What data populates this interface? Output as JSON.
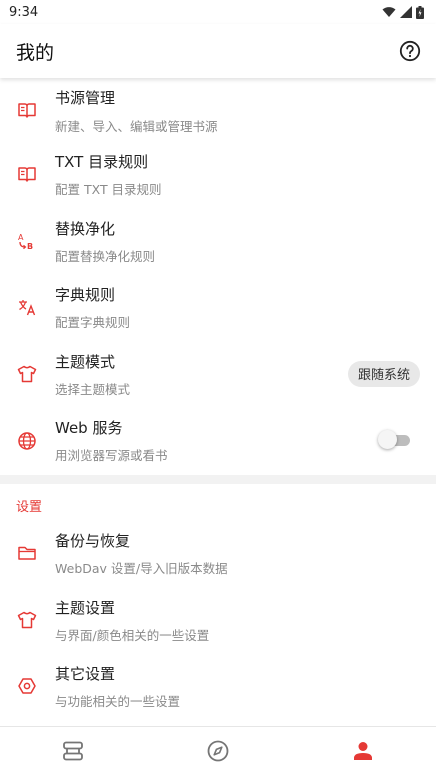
{
  "status_bar": {
    "time": "9:34"
  },
  "app_bar": {
    "title": "我的"
  },
  "colors": {
    "accent": "#e53935",
    "icon_gray": "#757575"
  },
  "items": [
    {
      "title": "书源管理",
      "subtitle": "新建、导入、编辑或管理书源",
      "icon": "book-icon"
    },
    {
      "title": "TXT 目录规则",
      "subtitle": "配置 TXT 目录规则",
      "icon": "book-icon"
    },
    {
      "title": "替换净化",
      "subtitle": "配置替换净化规则",
      "icon": "replace-icon"
    },
    {
      "title": "字典规则",
      "subtitle": "配置字典规则",
      "icon": "translate-icon"
    },
    {
      "title": "主题模式",
      "subtitle": "选择主题模式",
      "icon": "shirt-icon",
      "value": "跟随系统"
    },
    {
      "title": "Web 服务",
      "subtitle": "用浏览器写源或看书",
      "icon": "globe-icon",
      "switch_on": false
    }
  ],
  "settings_section": {
    "header": "设置",
    "items": [
      {
        "title": "备份与恢复",
        "subtitle": "WebDav 设置/导入旧版本数据",
        "icon": "folder-icon"
      },
      {
        "title": "主题设置",
        "subtitle": "与界面/颜色相关的一些设置",
        "icon": "shirt-icon"
      },
      {
        "title": "其它设置",
        "subtitle": "与功能相关的一些设置",
        "icon": "settings-icon"
      }
    ]
  },
  "bottom_nav": {
    "items": [
      {
        "icon": "bookshelf-icon",
        "active": false
      },
      {
        "icon": "compass-icon",
        "active": false
      },
      {
        "icon": "person-icon",
        "active": true
      }
    ]
  }
}
